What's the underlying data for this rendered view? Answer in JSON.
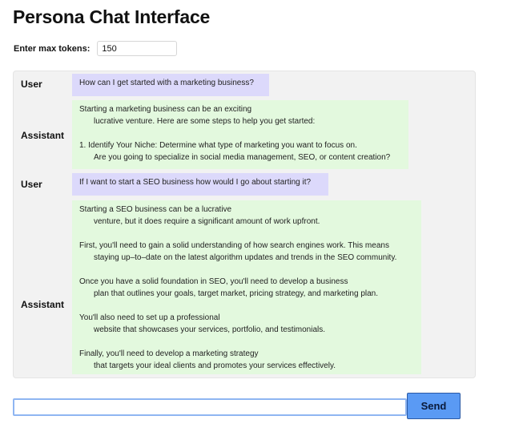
{
  "title": "Persona Chat Interface",
  "tokens": {
    "label": "Enter max tokens:",
    "value": "150"
  },
  "messages": [
    {
      "role": "User",
      "lines": [
        "How can I get started with a marketing business?"
      ]
    },
    {
      "role": "Assistant",
      "lines": [
        "Starting a marketing business can be an exciting",
        "lucrative venture. Here are some steps to help you get started:",
        "1. Identify Your Niche: Determine what type of marketing you want to focus on.",
        "Are you going to specialize in social media management, SEO, or content creation?"
      ]
    },
    {
      "role": "User",
      "lines": [
        "If I want to start a SEO business how would I go about starting it?"
      ]
    },
    {
      "role": "Assistant",
      "lines": [
        "Starting a SEO business can be a lucrative",
        "venture, but it does require a significant amount of work upfront.",
        "First, you'll need to gain a solid understanding of how search engines work. This means",
        "staying up–to–date on the latest algorithm updates and trends in the SEO community.",
        "Once you have a solid foundation in SEO, you'll need to develop a business",
        "plan that outlines your goals, target market, pricing strategy, and marketing plan.",
        "You'll also need to set up a professional",
        "website that showcases your services, portfolio, and testimonials.",
        "Finally, you'll need to develop a marketing strategy",
        "that targets your ideal clients and promotes your services effectively."
      ]
    }
  ],
  "input": {
    "value": ""
  },
  "send_label": "Send"
}
